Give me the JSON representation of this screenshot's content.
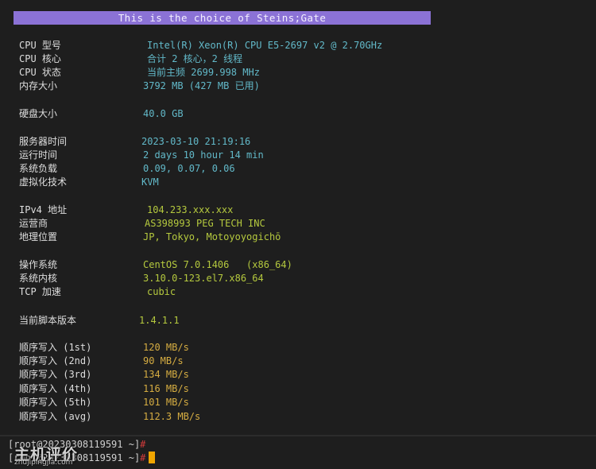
{
  "banner": "This is the choice of Steins;Gate",
  "system": {
    "cpu_model_label": "CPU 型号",
    "cpu_model": "Intel(R) Xeon(R) CPU E5-2697 v2 @ 2.70GHz",
    "cpu_cores_label": "CPU 核心",
    "cpu_cores": "合计 2 核心，2 线程",
    "cpu_status_label": "CPU 状态",
    "cpu_status": "当前主频 2699.998 MHz",
    "memory_label": "内存大小",
    "memory": "3792 MB (427 MB 已用)",
    "disk_label": "硬盘大小",
    "disk": "40.0 GB",
    "server_time_label": "服务器时间",
    "server_time": "2023-03-10 21:19:16",
    "uptime_label": "运行时间",
    "uptime": "2 days 10 hour 14 min",
    "load_label": "系统负载",
    "load": "0.09, 0.07, 0.06",
    "virt_label": "虚拟化技术",
    "virt": "KVM"
  },
  "network": {
    "ipv4_label": "IPv4 地址",
    "ipv4": "104.233.xxx.xxx",
    "isp_label": "运营商",
    "isp": "AS398993 PEG TECH INC",
    "location_label": "地理位置",
    "location": "JP, Tokyo, Motoyoyogichō"
  },
  "os": {
    "os_label": "操作系统",
    "os": "CentOS 7.0.1406   (x86_64)",
    "kernel_label": "系统内核",
    "kernel": "3.10.0-123.el7.x86_64",
    "tcp_label": "TCP 加速",
    "tcp": "cubic"
  },
  "script": {
    "version_label": "当前脚本版本",
    "version": "1.4.1.1"
  },
  "disk_io": [
    {
      "label": "顺序写入 (1st)",
      "value": "120 MB/s"
    },
    {
      "label": "顺序写入 (2nd)",
      "value": "90 MB/s"
    },
    {
      "label": "顺序写入 (3rd)",
      "value": "134 MB/s"
    },
    {
      "label": "顺序写入 (4th)",
      "value": "116 MB/s"
    },
    {
      "label": "顺序写入 (5th)",
      "value": "101 MB/s"
    },
    {
      "label": "顺序写入 (avg)",
      "value": "112.3 MB/s"
    }
  ],
  "prompts": [
    {
      "text": "[root@20230308119591 ~]",
      "symbol": "#"
    },
    {
      "text": "[root@20230308119591 ~]",
      "symbol": "#"
    }
  ],
  "watermark": {
    "main": "主机评价",
    "sub": "zhujipingjia.com"
  },
  "colors": {
    "background": "#1e1e1e",
    "banner": "#8b72d6",
    "cyan": "#62b9c9",
    "green": "#b5c93e",
    "yellow": "#d6ad42",
    "hash": "#d23b3b",
    "cursor": "#f0a500"
  }
}
